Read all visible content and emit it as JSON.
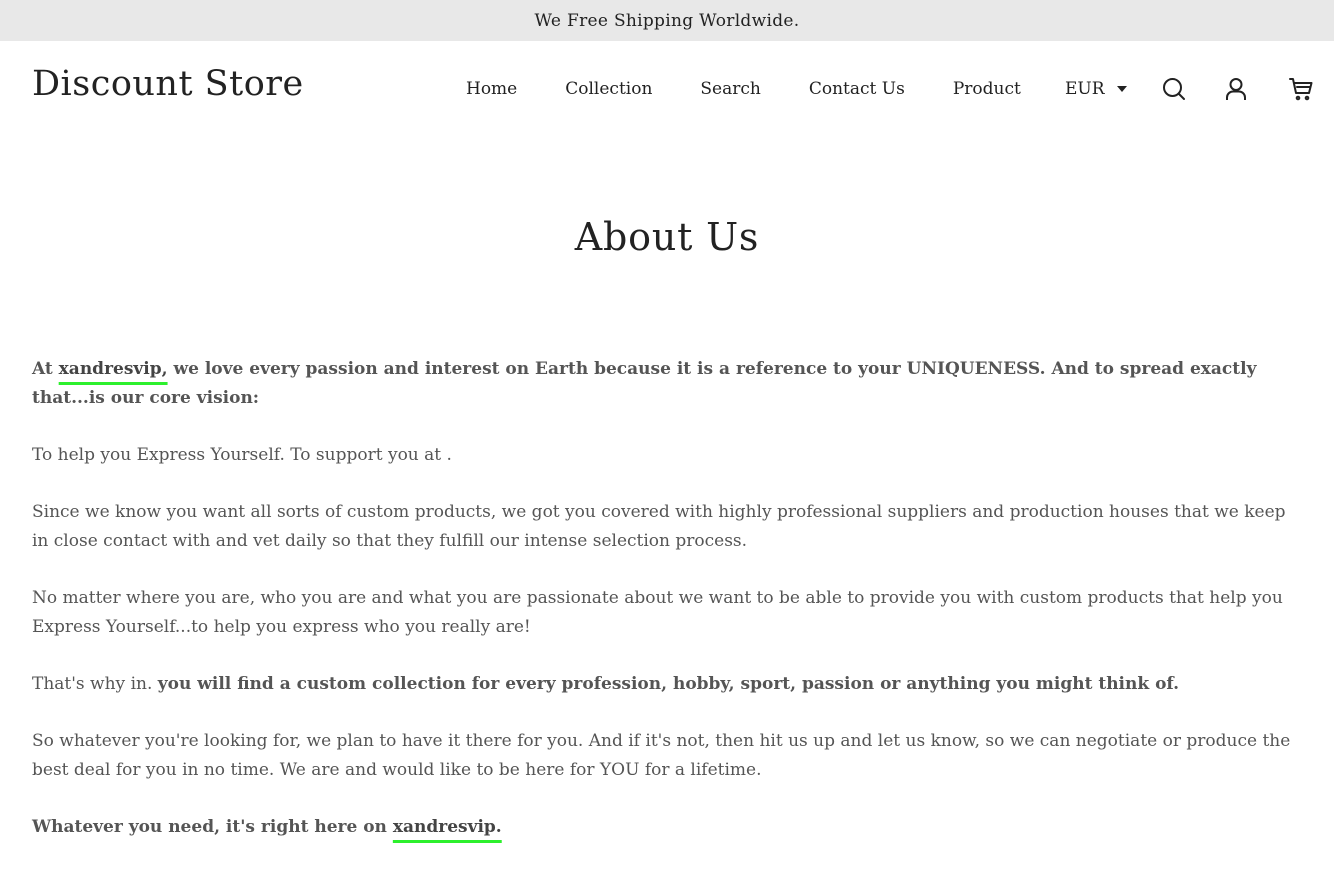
{
  "announcement": {
    "text": "We Free Shipping Worldwide."
  },
  "header": {
    "logo": "Discount Store",
    "nav": [
      "Home",
      "Collection",
      "Search",
      "Contact Us",
      "Product"
    ],
    "currency": "EUR",
    "icons": [
      "search-icon",
      "account-icon",
      "cart-icon"
    ]
  },
  "page": {
    "title": "About Us",
    "p1": {
      "prefix": "At ",
      "brand": "xandresvip,",
      "rest": " we love every passion and interest on Earth because it is a reference to your UNIQUENESS. And to spread exactly that...is our core vision:"
    },
    "p2": "To help you Express Yourself. To support you at .",
    "p3": "Since we know you want all sorts of custom products, we got you covered with highly professional suppliers and production houses that we keep in close contact with and vet daily so that they fulfill our intense selection process.",
    "p4": "No matter where you are, who you are and what you are passionate about we want to be able to provide you with custom products that help you Express Yourself...to help you express who you really are!",
    "p5": {
      "prefix": "That's why in. ",
      "bold": "you will find a custom collection for every profession, hobby, sport, passion or anything you might think of."
    },
    "p6": "So whatever you're looking for, we plan to have it there for you. And if it's not, then hit us up and let us know, so we can negotiate or produce the best deal for you in no time. We are and would like to be here for YOU for a lifetime.",
    "p7": {
      "prefix": "Whatever you need, it's right here on ",
      "brand": "xandresvip."
    }
  },
  "colors": {
    "announcement_bg": "#e8e8e8",
    "highlight_underline": "#2df02d",
    "text": "#555555",
    "heading": "#222222"
  }
}
